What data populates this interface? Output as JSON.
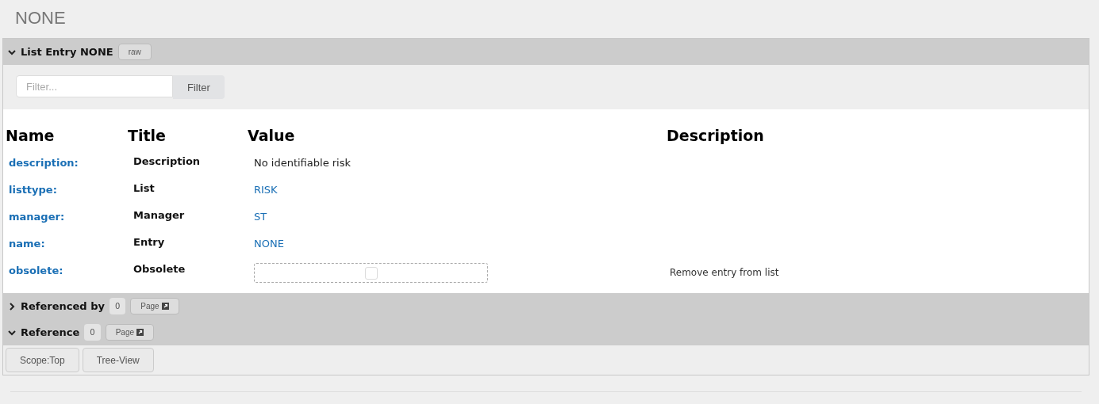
{
  "page_title": "NONE",
  "entry_section": {
    "title": "List Entry NONE",
    "expanded": true,
    "raw_button": "raw"
  },
  "filter": {
    "placeholder": "Filter...",
    "button": "Filter"
  },
  "table": {
    "columns": [
      "Name",
      "Title",
      "Value",
      "Description"
    ],
    "rows": [
      {
        "name": "description:",
        "title": "Description",
        "kind": "text",
        "value": "No identifiable risk"
      },
      {
        "name": "listtype:",
        "title": "List",
        "kind": "link",
        "value": "RISK"
      },
      {
        "name": "manager:",
        "title": "Manager",
        "kind": "link",
        "value": "ST"
      },
      {
        "name": "name:",
        "title": "Entry",
        "kind": "link",
        "value": "NONE"
      },
      {
        "name": "obsolete:",
        "title": "Obsolete",
        "kind": "checkbox",
        "checked": false,
        "description": "Remove entry from list"
      }
    ]
  },
  "reference_sections": [
    {
      "title": "Referenced by",
      "expanded": false,
      "count": "0",
      "page_button": "Page"
    },
    {
      "title": "Reference",
      "expanded": true,
      "count": "0",
      "page_button": "Page"
    }
  ],
  "footer_buttons": [
    "Scope:Top",
    "Tree-View"
  ]
}
